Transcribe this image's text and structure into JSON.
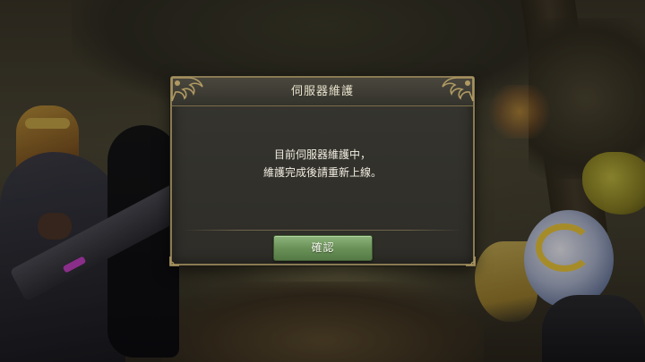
{
  "dialog": {
    "title": "伺服器維護",
    "message_line1": "目前伺服器維護中，",
    "message_line2": "維護完成後請重新上線。",
    "confirm_label": "確認"
  },
  "colors": {
    "dialog_border": "#8a7a52",
    "dialog_bg": "#2e2d28",
    "button_green": "#6a9258",
    "text_light": "#f2eee2"
  }
}
